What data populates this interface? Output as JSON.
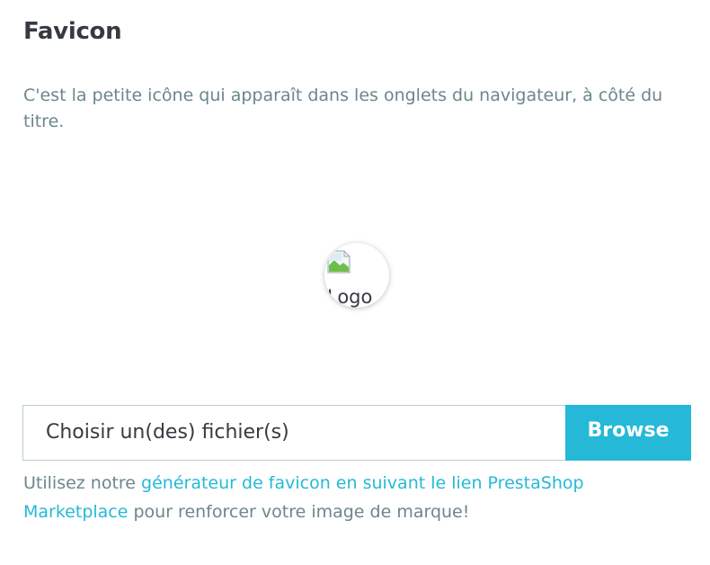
{
  "section": {
    "title": "Favicon",
    "description": "C'est la petite icône qui apparaît dans les onglets du navigateur, à côté du titre."
  },
  "preview": {
    "alt_text": "Logo",
    "icon": "broken-image-icon"
  },
  "file_input": {
    "placeholder": "Choisir un(des) fichier(s)",
    "browse_label": "Browse"
  },
  "help": {
    "prefix": "Utilisez notre ",
    "link_text": "générateur de favicon en suivant le lien PrestaShop Marketplace",
    "suffix": " pour renforcer votre image de marque!"
  },
  "colors": {
    "accent": "#25b9d7",
    "text_muted": "#6c868e",
    "text_dark": "#363a41",
    "border": "#bbcdd2"
  }
}
